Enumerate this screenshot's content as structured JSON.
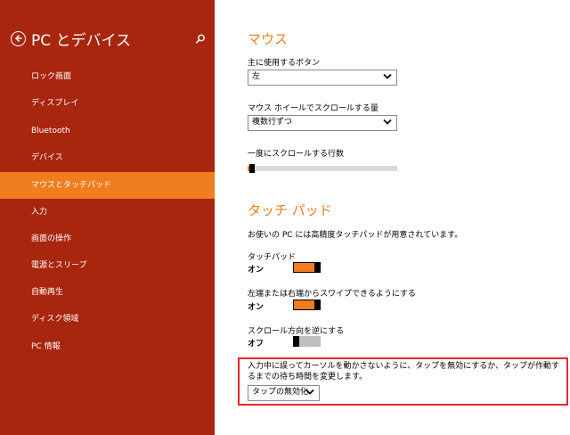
{
  "sidebar": {
    "title": "PC とデバイス",
    "items": [
      {
        "label": "ロック画面",
        "selected": false
      },
      {
        "label": "ディスプレイ",
        "selected": false
      },
      {
        "label": "Bluetooth",
        "selected": false
      },
      {
        "label": "デバイス",
        "selected": false
      },
      {
        "label": "マウスとタッチパッド",
        "selected": true
      },
      {
        "label": "入力",
        "selected": false
      },
      {
        "label": "画面の操作",
        "selected": false
      },
      {
        "label": "電源とスリープ",
        "selected": false
      },
      {
        "label": "自動再生",
        "selected": false
      },
      {
        "label": "ディスク領域",
        "selected": false
      },
      {
        "label": "PC 情報",
        "selected": false
      }
    ]
  },
  "mouse": {
    "title": "マウス",
    "primary_button": {
      "label": "主に使用するボタン",
      "value": "左"
    },
    "wheel_scroll": {
      "label": "マウス ホイールでスクロールする量",
      "value": "複数行ずつ"
    },
    "lines_to_scroll": {
      "label": "一度にスクロールする行数",
      "level": 0.03
    }
  },
  "touchpad": {
    "title": "タッチ パッド",
    "description": "お使いの PC には高精度タッチパッドが用意されています。",
    "touchpad_toggle": {
      "label": "タッチパッド",
      "state_label": "オン",
      "on": true
    },
    "edge_swipe": {
      "label": "左端または右端からスワイプできるようにする",
      "state_label": "オン",
      "on": true
    },
    "reverse_scroll": {
      "label": "スクロール方向を逆にする",
      "state_label": "オフ",
      "on": false
    },
    "delay_note": "入力中に誤ってカーソルを動かさないように、タップを無効にするか、タップが作動するまでの待ち時間を変更します。",
    "delay_value": "タップの無効化"
  },
  "colors": {
    "sidebar_bg": "#A8260E",
    "accent": "#F07D1E",
    "highlight_border": "#E8282E"
  }
}
